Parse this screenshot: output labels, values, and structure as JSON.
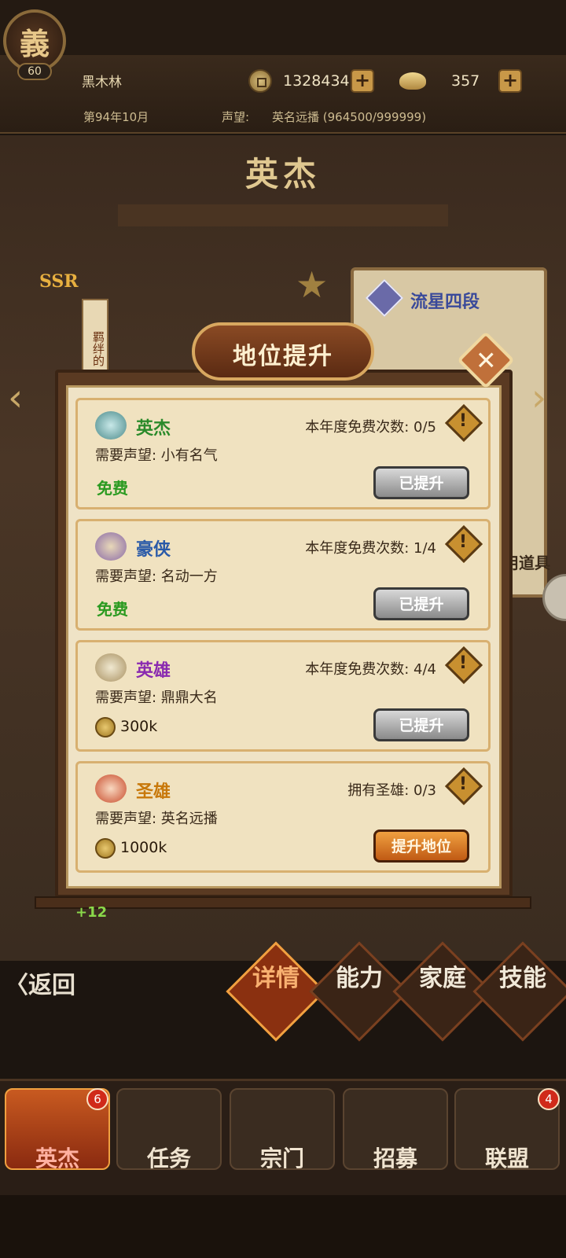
{
  "header": {
    "emblem_char": "義",
    "level": "60",
    "player_name": "黑木林",
    "coins": "1328434",
    "ingots": "357",
    "date": "第94年10月",
    "reputation_label": "声望:",
    "reputation_value": "英名远播 (964500/999999)"
  },
  "scene": {
    "title": "英杰",
    "rarity": "SSR",
    "bond_tag": "羁绊的",
    "skill_name": "流星四段",
    "items_label": "用道具"
  },
  "modal": {
    "title": "地位提升",
    "tiers": [
      {
        "name": "英杰",
        "name_color": "#2a8a2a",
        "count": "本年度免费次数: 0/5",
        "requirement": "需要声望: 小有名气",
        "cost": "免费",
        "button": "已提升"
      },
      {
        "name": "豪侠",
        "name_color": "#2a5aa8",
        "count": "本年度免费次数: 1/4",
        "requirement": "需要声望: 名动一方",
        "cost": "免费",
        "button": "已提升"
      },
      {
        "name": "英雄",
        "name_color": "#8a2ab0",
        "count": "本年度免费次数: 4/4",
        "requirement": "需要声望: 鼎鼎大名",
        "cost": "300k",
        "button": "已提升"
      },
      {
        "name": "圣雄",
        "name_color": "#c8780a",
        "count": "拥有圣雄: 0/3",
        "requirement": "需要声望: 英名远播",
        "cost": "1000k",
        "button": "提升地位"
      }
    ],
    "plus_bonus": "+12"
  },
  "actions": {
    "back": "〈返回",
    "tabs": [
      "详情",
      "能力",
      "家庭",
      "技能"
    ]
  },
  "bottom_nav": {
    "items": [
      {
        "label": "英杰",
        "badge": "6"
      },
      {
        "label": "任务",
        "badge": ""
      },
      {
        "label": "宗门",
        "badge": ""
      },
      {
        "label": "招募",
        "badge": ""
      },
      {
        "label": "联盟",
        "badge": "4"
      }
    ]
  },
  "colors": {
    "accent": "#c05a14",
    "free_green": "#2a9a20",
    "panel": "#efe3c6"
  }
}
